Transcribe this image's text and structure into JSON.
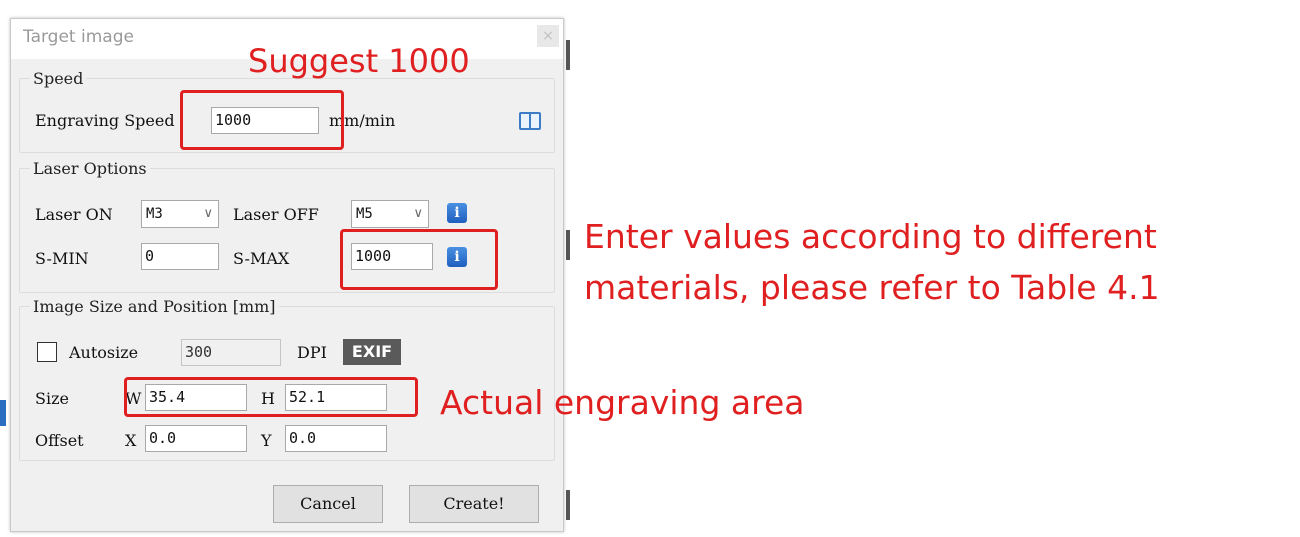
{
  "dialog": {
    "title": "Target image",
    "close_glyph": "×",
    "speed": {
      "legend": "Speed",
      "engraving_speed_label": "Engraving Speed",
      "engraving_speed_value": "1000",
      "unit": "mm/min",
      "manual_icon": "book-icon"
    },
    "laser": {
      "legend": "Laser Options",
      "laser_on_label": "Laser ON",
      "laser_on_value": "M3",
      "laser_off_label": "Laser OFF",
      "laser_off_value": "M5",
      "smin_label": "S-MIN",
      "smin_value": "0",
      "smax_label": "S-MAX",
      "smax_value": "1000",
      "info_glyph": "i"
    },
    "image": {
      "legend": "Image Size and Position [mm]",
      "autosize_label": "Autosize",
      "autosize_checked": false,
      "dpi_value": "300",
      "dpi_label": "DPI",
      "exif_label": "EXIF",
      "size_label": "Size",
      "w_label": "W",
      "w_value": "35.4",
      "h_label": "H",
      "h_value": "52.1",
      "offset_label": "Offset",
      "x_label": "X",
      "x_value": "0.0",
      "y_label": "Y",
      "y_value": "0.0"
    },
    "buttons": {
      "cancel": "Cancel",
      "create": "Create!"
    }
  },
  "annotations": {
    "suggest": "Suggest 1000",
    "materials_line1": "Enter values according to different",
    "materials_line2": "materials, please refer to Table 4.1",
    "area": "Actual engraving area",
    "color": "#e02020"
  }
}
